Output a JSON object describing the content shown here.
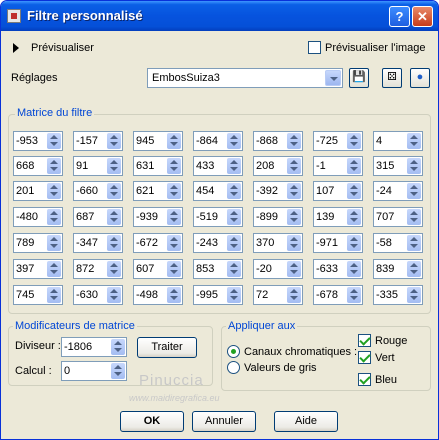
{
  "window": {
    "title": "Filtre personnalisé"
  },
  "preview": {
    "label": "Prévisualiser",
    "image_label": "Prévisualiser l'image",
    "image_checked": false
  },
  "settings": {
    "label": "Réglages",
    "preset": "EmbosSuiza3"
  },
  "matrix": {
    "title": "Matrice du filtre",
    "rows": [
      [
        "-953",
        "-157",
        "945",
        "-864",
        "-868",
        "-725",
        "4"
      ],
      [
        "668",
        "91",
        "631",
        "433",
        "208",
        "-1",
        "315"
      ],
      [
        "201",
        "-660",
        "621",
        "454",
        "-392",
        "107",
        "-24"
      ],
      [
        "-480",
        "687",
        "-939",
        "-519",
        "-899",
        "139",
        "707"
      ],
      [
        "789",
        "-347",
        "-672",
        "-243",
        "370",
        "-971",
        "-58"
      ],
      [
        "397",
        "872",
        "607",
        "853",
        "-20",
        "-633",
        "839"
      ],
      [
        "745",
        "-630",
        "-498",
        "-995",
        "72",
        "-678",
        "-335"
      ]
    ]
  },
  "modifiers": {
    "title": "Modificateurs de matrice",
    "divisor_label": "Diviseur :",
    "divisor": "-1806",
    "bias_label": "Calcul :",
    "bias": "0",
    "apply_button": "Traiter"
  },
  "apply_to": {
    "title": "Appliquer aux",
    "channels_label": "Canaux chromatiques :",
    "gray_label": "Valeurs de gris",
    "red": "Rouge",
    "green": "Vert",
    "blue": "Bleu"
  },
  "watermark": {
    "name": "Pinuccia",
    "url": "www.maidiregrafica.eu"
  },
  "buttons": {
    "ok": "OK",
    "cancel": "Annuler",
    "help": "Aide"
  }
}
